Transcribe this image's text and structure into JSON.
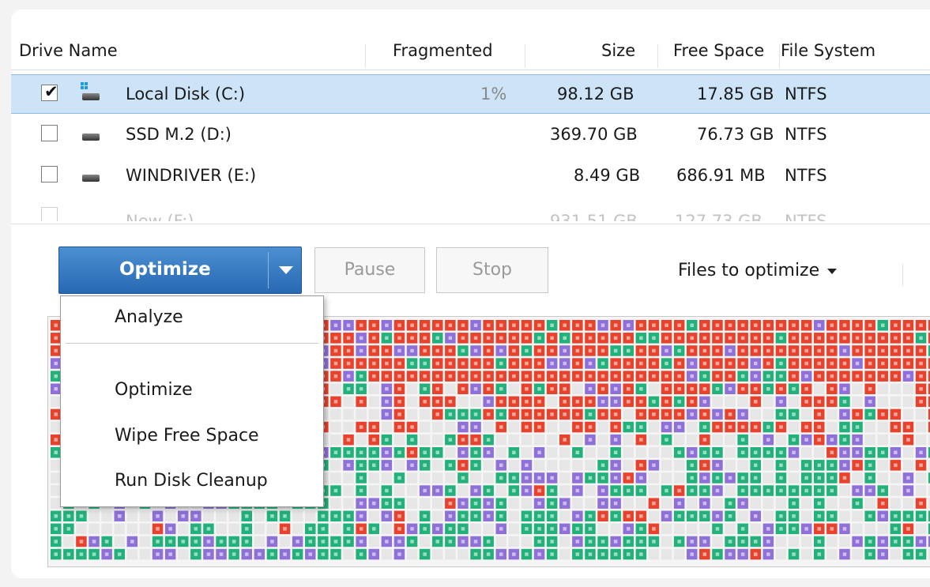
{
  "table": {
    "headers": {
      "drive_name": "Drive Name",
      "fragmented": "Fragmented",
      "size": "Size",
      "free_space": "Free Space",
      "file_system": "File System"
    },
    "rows": [
      {
        "checked": true,
        "icon": "windows-drive-icon",
        "name": "Local Disk (C:)",
        "fragmented": "1%",
        "size": "98.12 GB",
        "free": "17.85 GB",
        "fs": "NTFS"
      },
      {
        "checked": false,
        "icon": "drive-icon",
        "name": "SSD M.2 (D:)",
        "fragmented": "",
        "size": "369.70 GB",
        "free": "76.73 GB",
        "fs": "NTFS"
      },
      {
        "checked": false,
        "icon": "drive-icon",
        "name": "WINDRIVER (E:)",
        "fragmented": "",
        "size": "8.49 GB",
        "free": "686.91 MB",
        "fs": "NTFS"
      },
      {
        "checked": false,
        "icon": "drive-icon",
        "name": "New (F:)",
        "fragmented": "",
        "size": "931.51 GB",
        "free": "127.73 GB",
        "fs": "NTFS"
      }
    ]
  },
  "toolbar": {
    "optimize_label": "Optimize",
    "pause_label": "Pause",
    "stop_label": "Stop",
    "files_to_optimize_label": "Files to optimize"
  },
  "dropdown_menu": {
    "items": [
      "Analyze",
      "Optimize",
      "Wipe Free Space",
      "Run Disk Cleanup"
    ]
  },
  "colors": {
    "fragmented": "#e8412c",
    "contiguous": "#22b17a",
    "system": "#8f6fd8",
    "free": "#e6e6e6",
    "selection": "#cde3f7",
    "accent": "#2f74c0"
  }
}
